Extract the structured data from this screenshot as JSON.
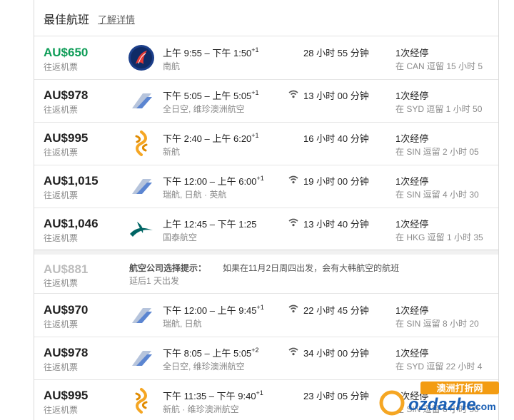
{
  "header": {
    "title": "最佳航班",
    "link": "了解详情"
  },
  "flights_a": [
    {
      "price": "AU$650",
      "price_sub": "往返机票",
      "best": true,
      "logo": "china-southern-logo",
      "times": "上午 9:55 – 下午 1:50",
      "plus": "+1",
      "airline": "南航",
      "wifi": false,
      "duration": "28 小时 55 分钟",
      "stops": "1次经停",
      "layover": "在 CAN 逗留 15 小时 5"
    },
    {
      "price": "AU$978",
      "price_sub": "往返机票",
      "best": false,
      "logo": "tail-fin-logo",
      "times": "下午 5:05 – 上午 5:05",
      "plus": "+1",
      "airline": "全日空, 维珍澳洲航空",
      "wifi": true,
      "duration": "13 小时 00 分钟",
      "stops": "1次经停",
      "layover": "在 SYD 逗留 1 小时 50"
    },
    {
      "price": "AU$995",
      "price_sub": "往返机票",
      "best": false,
      "logo": "singapore-airlines-logo",
      "times": "下午 2:40 – 上午 6:20",
      "plus": "+1",
      "airline": "新航",
      "wifi": false,
      "duration": "16 小时 40 分钟",
      "stops": "1次经停",
      "layover": "在 SIN 逗留 2 小时 05"
    },
    {
      "price": "AU$1,015",
      "price_sub": "往返机票",
      "best": false,
      "logo": "tail-fin-logo",
      "times": "下午 12:00 – 上午 6:00",
      "plus": "+1",
      "airline": "瑞航, 日航 · 英航",
      "wifi": true,
      "duration": "19 小时 00 分钟",
      "stops": "1次经停",
      "layover": "在 SIN 逗留 4 小时 30"
    },
    {
      "price": "AU$1,046",
      "price_sub": "往返机票",
      "best": false,
      "logo": "cathay-pacific-logo",
      "times": "上午 12:45 – 下午 1:25",
      "plus": "",
      "airline": "国泰航空",
      "wifi": true,
      "duration": "13 小时 40 分钟",
      "stops": "1次经停",
      "layover": "在 HKG 逗留 1 小时 35"
    }
  ],
  "tip": {
    "price": "AU$881",
    "price_sub": "往返机票",
    "label": "航空公司选择提示：",
    "text": "如果在11月2日周四出发，会有大韩航空的航班",
    "line2": "延后1 天出发"
  },
  "flights_b": [
    {
      "price": "AU$970",
      "price_sub": "往返机票",
      "best": false,
      "logo": "tail-fin-logo",
      "times": "下午 12:00 – 上午 9:45",
      "plus": "+1",
      "airline": "瑞航, 日航",
      "wifi": true,
      "duration": "22 小时 45 分钟",
      "stops": "1次经停",
      "layover": "在 SIN 逗留 8 小时 20"
    },
    {
      "price": "AU$978",
      "price_sub": "往返机票",
      "best": false,
      "logo": "tail-fin-logo",
      "times": "下午 8:05 – 上午 5:05",
      "plus": "+2",
      "airline": "全日空, 维珍澳洲航空",
      "wifi": true,
      "duration": "34 小时 00 分钟",
      "stops": "1次经停",
      "layover": "在 SYD 逗留 22 小时 4"
    },
    {
      "price": "AU$995",
      "price_sub": "往返机票",
      "best": false,
      "logo": "singapore-airlines-logo",
      "times": "下午 11:35 – 下午 9:40",
      "plus": "+1",
      "airline": "新航 · 维珍澳洲航空",
      "wifi": false,
      "duration": "23 小时 05 分钟",
      "stops": "1次经停",
      "layover": "在 SIN 逗留 6 小时 50"
    }
  ],
  "watermark": {
    "line1": "澳洲打折网",
    "line2": "ozdazhe.com"
  }
}
